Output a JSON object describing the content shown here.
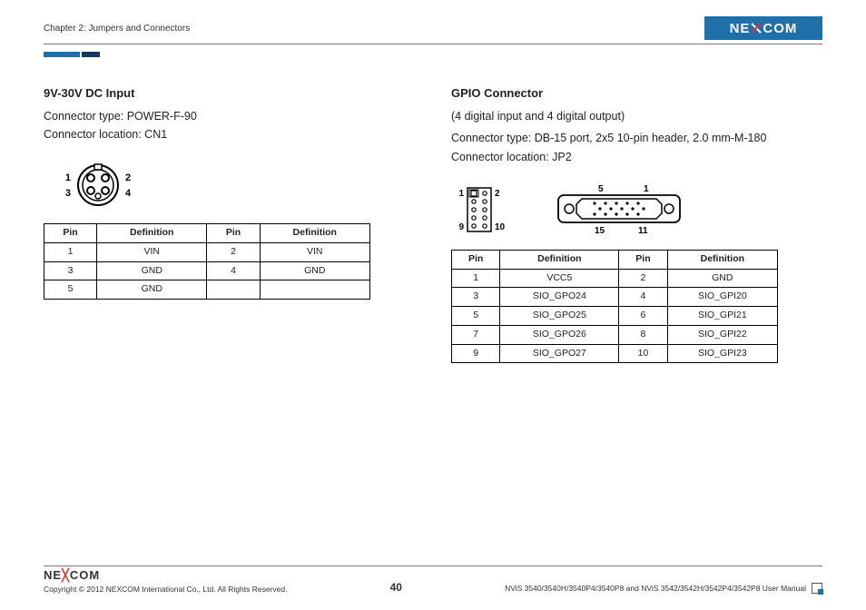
{
  "header": {
    "chapter": "Chapter 2: Jumpers and Connectors",
    "logo_text": "NE COM",
    "logo_x": "X"
  },
  "left": {
    "title": "9V-30V DC Input",
    "line1": "Connector type: POWER-F-90",
    "line2": "Connector location: CN1",
    "diagram_labels": {
      "l1": "1",
      "l2": "2",
      "l3": "3",
      "l4": "4"
    },
    "table_headers": {
      "pin": "Pin",
      "def": "Definition"
    },
    "rows": [
      {
        "p1": "1",
        "d1": "VIN",
        "p2": "2",
        "d2": "VIN"
      },
      {
        "p1": "3",
        "d1": "GND",
        "p2": "4",
        "d2": "GND"
      },
      {
        "p1": "5",
        "d1": "GND",
        "p2": "",
        "d2": ""
      }
    ]
  },
  "right": {
    "title": "GPIO Connector",
    "sub": "(4 digital input and 4 digital output)",
    "line1": "Connector type: DB-15 port, 2x5 10-pin header, 2.0 mm-M-180",
    "line2": "Connector location: JP2",
    "header_labels": {
      "h1": "1",
      "h2": "2",
      "h9": "9",
      "h10": "10",
      "db5": "5",
      "db1": "1",
      "db15": "15",
      "db11": "11"
    },
    "table_headers": {
      "pin": "Pin",
      "def": "Definition"
    },
    "rows": [
      {
        "p1": "1",
        "d1": "VCC5",
        "p2": "2",
        "d2": "GND"
      },
      {
        "p1": "3",
        "d1": "SIO_GPO24",
        "p2": "4",
        "d2": "SIO_GPI20"
      },
      {
        "p1": "5",
        "d1": "SIO_GPO25",
        "p2": "6",
        "d2": "SIO_GPI21"
      },
      {
        "p1": "7",
        "d1": "SIO_GPO26",
        "p2": "8",
        "d2": "SIO_GPI22"
      },
      {
        "p1": "9",
        "d1": "SIO_GPO27",
        "p2": "10",
        "d2": "SIO_GPI23"
      }
    ]
  },
  "footer": {
    "logo": "NEXCOM",
    "copyright": "Copyright © 2012 NEXCOM International Co., Ltd. All Rights Reserved.",
    "page": "40",
    "manual": "NViS 3540/3540H/3540P4/3540P8 and NViS 3542/3542H/3542P4/3542P8 User Manual"
  }
}
